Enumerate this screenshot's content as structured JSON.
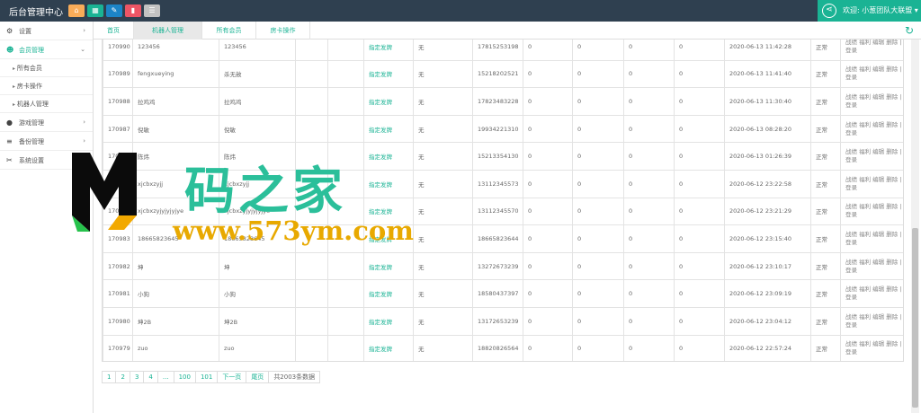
{
  "app_title": "后台管理中心",
  "toolbar_icons": [
    {
      "name": "home-icon",
      "glyph": "⌂",
      "color": "#f8ac59"
    },
    {
      "name": "grid-icon",
      "glyph": "▦",
      "color": "#1ab394"
    },
    {
      "name": "edit-icon",
      "glyph": "✎",
      "color": "#1c84c6"
    },
    {
      "name": "trash-icon",
      "glyph": "▮",
      "color": "#ed5565"
    },
    {
      "name": "list-icon",
      "glyph": "☰",
      "color": "#c2c2c2"
    }
  ],
  "welcome": "欢迎: 小葱团队大联盟 ▾",
  "sidebar": {
    "items": [
      {
        "label": "设置",
        "icon": "gear-icon",
        "glyph": "⚙",
        "chevron": "›"
      },
      {
        "label": "会员管理",
        "icon": "users-icon",
        "glyph": "☻",
        "chevron": "⌄",
        "active": true
      }
    ],
    "subitems": [
      "所有会员",
      "房卡操作",
      "机器人管理"
    ],
    "items2": [
      {
        "label": "游戏管理",
        "icon": "soccer-icon",
        "glyph": "●",
        "chevron": "›"
      },
      {
        "label": "备份管理",
        "icon": "database-icon",
        "glyph": "≡",
        "chevron": "›"
      },
      {
        "label": "系统设置",
        "icon": "wrench-icon",
        "glyph": "✂",
        "chevron": ""
      }
    ]
  },
  "tabs": [
    "首页",
    "机器人管理",
    "所有会员",
    "房卡操作"
  ],
  "table": {
    "rows": [
      [
        "170990",
        "123456",
        "123456",
        "",
        "",
        "指定发牌",
        "无",
        "17815253198",
        "0",
        "0",
        "0",
        "0",
        "2020-06-13 11:42:28",
        "正常",
        "战绩 福利 编辑 删除 | 登录"
      ],
      [
        "170989",
        "fengxueying",
        "杀无赦",
        "",
        "",
        "指定发牌",
        "无",
        "15218202521",
        "0",
        "0",
        "0",
        "0",
        "2020-06-13 11:41:40",
        "正常",
        "战绩 福利 编辑 删除 | 登录"
      ],
      [
        "170988",
        "拉鸡鸡",
        "拉鸡鸡",
        "",
        "",
        "指定发牌",
        "无",
        "17823483228",
        "0",
        "0",
        "0",
        "0",
        "2020-06-13 11:30:40",
        "正常",
        "战绩 福利 编辑 删除 | 登录"
      ],
      [
        "170987",
        "倪敏",
        "倪敏",
        "",
        "",
        "指定发牌",
        "无",
        "19934221310",
        "0",
        "0",
        "0",
        "0",
        "2020-06-13 08:28:20",
        "正常",
        "战绩 福利 编辑 删除 | 登录"
      ],
      [
        "170986",
        "陈炜",
        "陈炜",
        "",
        "",
        "指定发牌",
        "无",
        "15213354130",
        "0",
        "0",
        "0",
        "0",
        "2020-06-13 01:26:39",
        "正常",
        "战绩 福利 编辑 删除 | 登录"
      ],
      [
        "170985",
        "xjcbxzyjj",
        "xjcbxzyjj",
        "",
        "",
        "指定发牌",
        "无",
        "13112345573",
        "0",
        "0",
        "0",
        "0",
        "2020-06-12 23:22:58",
        "正常",
        "战绩 福利 编辑 删除 | 登录"
      ],
      [
        "170984",
        "xjcbxzyjyjyjyjye",
        "xjcbxzyjyjyjyjye",
        "",
        "",
        "指定发牌",
        "无",
        "13112345570",
        "0",
        "0",
        "0",
        "0",
        "2020-06-12 23:21:29",
        "正常",
        "战绩 福利 编辑 删除 | 登录"
      ],
      [
        "170983",
        "18665823645",
        "18665823645",
        "",
        "",
        "指定发牌",
        "无",
        "18665823644",
        "0",
        "0",
        "0",
        "0",
        "2020-06-12 23:15:40",
        "正常",
        "战绩 福利 编辑 删除 | 登录"
      ],
      [
        "170982",
        "坤",
        "坤",
        "",
        "",
        "指定发牌",
        "无",
        "13272673239",
        "0",
        "0",
        "0",
        "0",
        "2020-06-12 23:10:17",
        "正常",
        "战绩 福利 编辑 删除 | 登录"
      ],
      [
        "170981",
        "小狗",
        "小狗",
        "",
        "",
        "指定发牌",
        "无",
        "18580437397",
        "0",
        "0",
        "0",
        "0",
        "2020-06-12 23:09:19",
        "正常",
        "战绩 福利 编辑 删除 | 登录"
      ],
      [
        "170980",
        "坤2B",
        "坤2B",
        "",
        "",
        "指定发牌",
        "无",
        "13172653239",
        "0",
        "0",
        "0",
        "0",
        "2020-06-12 23:04:12",
        "正常",
        "战绩 福利 编辑 删除 | 登录"
      ],
      [
        "170979",
        "zuo",
        "zuo",
        "",
        "",
        "指定发牌",
        "无",
        "18820826564",
        "0",
        "0",
        "0",
        "0",
        "2020-06-12 22:57:24",
        "正常",
        "战绩 福利 编辑 删除 | 登录"
      ]
    ]
  },
  "pagination": [
    "1",
    "2",
    "3",
    "4",
    "...",
    "100",
    "101",
    "下一页",
    "尾页"
  ],
  "pagination_total": "共2003条数据",
  "watermark": {
    "logo": "M",
    "text": "码之家",
    "url": "www.573ym.com"
  }
}
